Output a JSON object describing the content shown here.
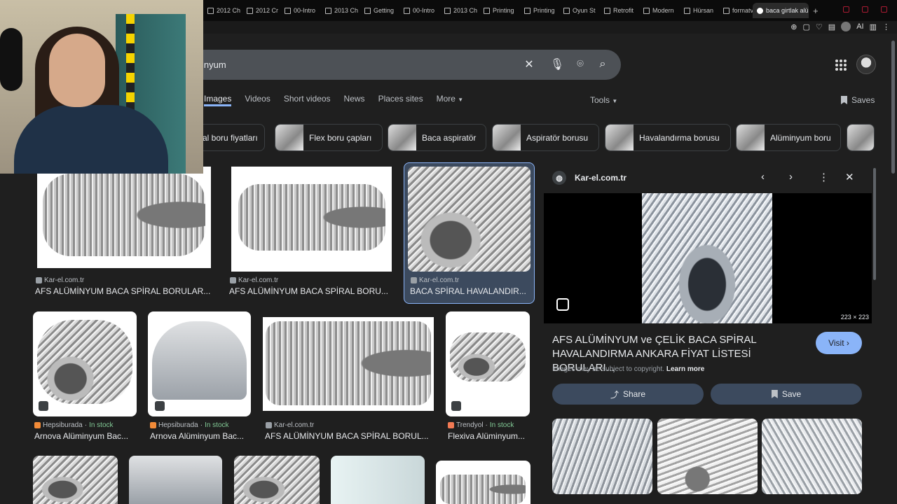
{
  "browser": {
    "tabs": [
      {
        "label": "2012 Ch"
      },
      {
        "label": "2012 Cr"
      },
      {
        "label": "00-Intro"
      },
      {
        "label": "2013 Ch"
      },
      {
        "label": "Getting"
      },
      {
        "label": "00-Intro"
      },
      {
        "label": "2013 Ch"
      },
      {
        "label": "Printing"
      },
      {
        "label": "Printing"
      },
      {
        "label": "Oyun St"
      },
      {
        "label": "Retrofit"
      },
      {
        "label": "Modern"
      },
      {
        "label": "Hürsan"
      },
      {
        "label": "formatv"
      },
      {
        "label": "baca girtlak alü"
      }
    ],
    "new_tab": "+",
    "toolbar_ai": "AI"
  },
  "search": {
    "query": "inyum"
  },
  "nav": {
    "tabs": [
      "Images",
      "Videos",
      "Short videos",
      "News",
      "Places sites",
      "More"
    ],
    "tools": "Tools",
    "saves": "Saves"
  },
  "chips": [
    {
      "label": "al boru fiyatları"
    },
    {
      "label": "Flex boru çapları"
    },
    {
      "label": "Baca aspiratör"
    },
    {
      "label": "Aspiratör borusu"
    },
    {
      "label": "Havalandırma borusu"
    },
    {
      "label": "Alüminyum boru"
    }
  ],
  "results": [
    {
      "source": "Kar-el.com.tr",
      "title": "AFS ALÜMİNYUM BACA SPİRAL BORULAR...",
      "stock": ""
    },
    {
      "source": "Kar-el.com.tr",
      "title": "AFS ALÜMİNYUM BACA SPİRAL BORU...",
      "stock": ""
    },
    {
      "source": "Kar-el.com.tr",
      "title": "BACA SPİRAL HAVALANDIR...",
      "stock": ""
    },
    {
      "source": "Hepsiburada",
      "title": "Arnova Alüminyum Bac...",
      "stock": "In stock"
    },
    {
      "source": "Hepsiburada",
      "title": "Arnova Alüminyum Bac...",
      "stock": "In stock"
    },
    {
      "source": "Kar-el.com.tr",
      "title": "AFS ALÜMİNYUM BACA SPİRAL BORUL...",
      "stock": ""
    },
    {
      "source": "Trendyol",
      "title": "Flexiva Alüminyum...",
      "stock": "In stock"
    }
  ],
  "preview": {
    "site": "Kar-el.com.tr",
    "dimensions": "223 × 223",
    "title": "AFS ALÜMİNYUM ve ÇELİK BACA SPİRAL HAVALANDIRMA ANKARA FİYAT LİSTESİ BORULARI...",
    "visit": "Visit",
    "copyright": "Images may be subject to copyright.",
    "learn_more": "Learn more",
    "share": "Share",
    "save": "Save"
  },
  "colors": {
    "accent": "#8ab4f8",
    "in_stock": "#81c995",
    "background": "#1f1f1f"
  }
}
